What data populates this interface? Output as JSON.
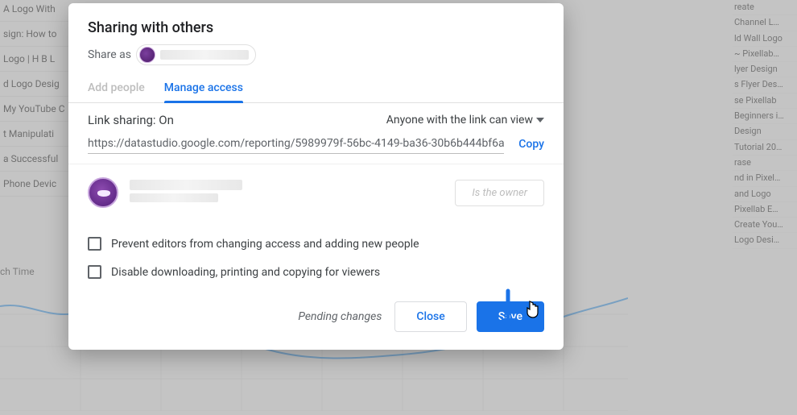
{
  "dialog": {
    "title": "Sharing with others",
    "share_as_label": "Share as",
    "tabs": {
      "add_people": "Add people",
      "manage_access": "Manage access"
    },
    "link_sharing_label": "Link sharing: On",
    "link_scope": "Anyone with the link can view",
    "url": "https://datastudio.google.com/reporting/5989979f-56bc-4149-ba36-30b6b444bf6a",
    "copy_label": "Copy",
    "owner_role": "Is the owner",
    "checkbox_prevent": "Prevent editors from changing access and adding new people",
    "checkbox_disable": "Disable downloading, printing and copying for viewers",
    "pending_label": "Pending changes",
    "close_label": "Close",
    "save_label": "Save"
  },
  "background": {
    "watch_time_label": "ch Time",
    "left_items": [
      "A Logo With",
      "sign: How to",
      "Logo | H B L",
      "d Logo Desig",
      "My YouTube C",
      "t Manipulati",
      "a Successful",
      "Phone Devic"
    ],
    "right_items": [
      "reate",
      "Channel L…",
      "ld Wall Logo",
      "~ Pixellab…",
      "lyer Design",
      "s Flyer Des…",
      "se Pixellab",
      "Beginners i…",
      "Design",
      "Tutorial 20…",
      "rase",
      "nd in Pixel…",
      "and Logo",
      "Pixellab E…",
      "Create You…",
      "Logo Desi…"
    ]
  }
}
